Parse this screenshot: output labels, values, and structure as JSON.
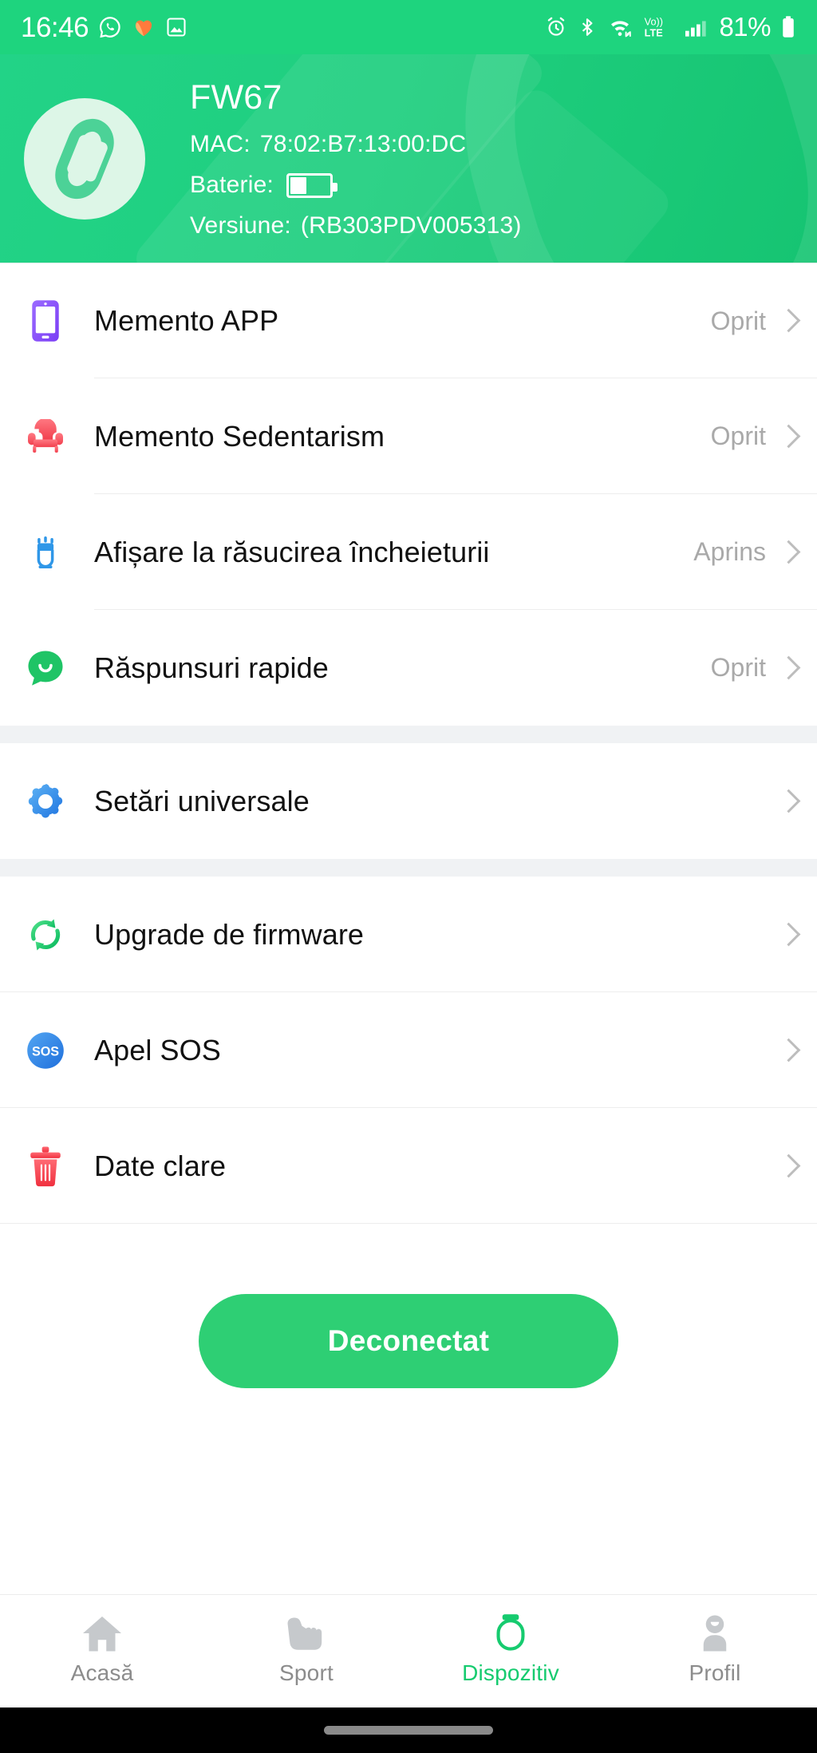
{
  "status_bar": {
    "time": "16:46",
    "left_icons": [
      "whatsapp-icon",
      "health-heart-icon",
      "gallery-icon"
    ],
    "right_icons": [
      "alarm-icon",
      "bluetooth-icon",
      "wifi-icon",
      "volte-icon",
      "cell-signal-icon"
    ],
    "battery_percent": "81%",
    "volte_label": "Vo))",
    "lte_label": "LTE"
  },
  "header": {
    "device_name": "FW67",
    "mac_label": "MAC:",
    "mac_value": "78:02:B7:13:00:DC",
    "battery_label": "Baterie:",
    "battery_level_percent": 38,
    "version_label": "Versiune:",
    "version_value": "(RB303PDV005313)",
    "avatar_icon": "fitness-band-icon",
    "background_color": "#1fcf7f"
  },
  "sections": [
    {
      "rows": [
        {
          "icon": "smartphone-icon",
          "label": "Memento APP",
          "value": "Oprit"
        },
        {
          "icon": "armchair-icon",
          "label": "Memento Sedentarism",
          "value": "Oprit"
        },
        {
          "icon": "wrist-raise-icon",
          "label": "Afișare la răsucirea încheieturii",
          "value": "Aprins"
        },
        {
          "icon": "chat-bubble-icon",
          "label": "Răspunsuri rapide",
          "value": "Oprit"
        }
      ]
    },
    {
      "rows": [
        {
          "icon": "gear-icon",
          "label": "Setări universale",
          "value": ""
        }
      ]
    },
    {
      "rows": [
        {
          "icon": "sync-refresh-icon",
          "label": "Upgrade de firmware",
          "value": ""
        },
        {
          "icon": "sos-icon",
          "label": "Apel SOS",
          "value": ""
        },
        {
          "icon": "trash-icon",
          "label": "Date clare",
          "value": ""
        }
      ]
    }
  ],
  "action": {
    "disconnect_label": "Deconectat",
    "button_color": "#2ecf74"
  },
  "bottom_nav": {
    "active_color": "#16cb6f",
    "inactive_color": "#8c8c8c",
    "items": [
      {
        "icon": "home-icon",
        "label": "Acasă",
        "active": false
      },
      {
        "icon": "shoe-icon",
        "label": "Sport",
        "active": false
      },
      {
        "icon": "band-device-icon",
        "label": "Dispozitiv",
        "active": true
      },
      {
        "icon": "person-icon",
        "label": "Profil",
        "active": false
      }
    ]
  }
}
